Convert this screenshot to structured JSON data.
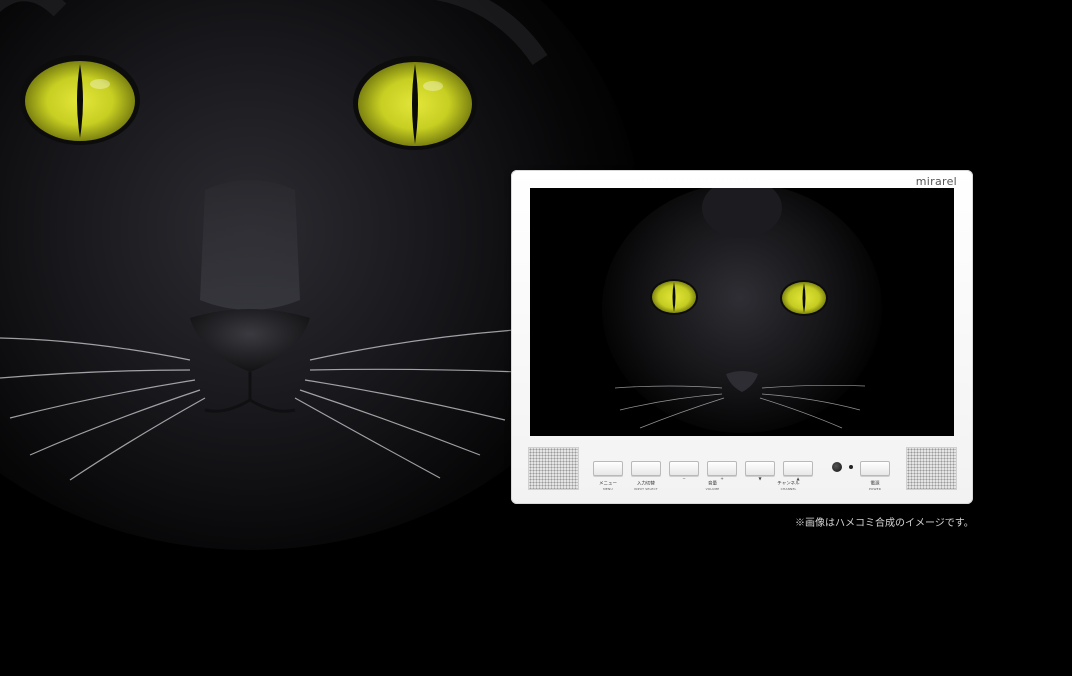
{
  "image": {
    "subject": "black-cat-face",
    "eye_color": "#c9d21e",
    "fur_color": "#1a1a1e"
  },
  "device": {
    "brand": "mirarel",
    "body_color": "#f5f5f5",
    "buttons": [
      {
        "label": "メニュー",
        "sublabel": "MENU",
        "mark": ""
      },
      {
        "label": "入力切替",
        "sublabel": "INPUT SELECT",
        "mark": ""
      },
      {
        "label": "",
        "sublabel": "",
        "mark": "−"
      },
      {
        "label": "音量",
        "sublabel": "VOLUME",
        "mark": "+"
      },
      {
        "label": "",
        "sublabel": "",
        "mark": "▼"
      },
      {
        "label": "チャンネル",
        "sublabel": "CHANNEL",
        "mark": "▲"
      },
      {
        "label": "電源",
        "sublabel": "POWER",
        "mark": ""
      }
    ]
  },
  "caption": "※画像はハメコミ合成のイメージです。"
}
